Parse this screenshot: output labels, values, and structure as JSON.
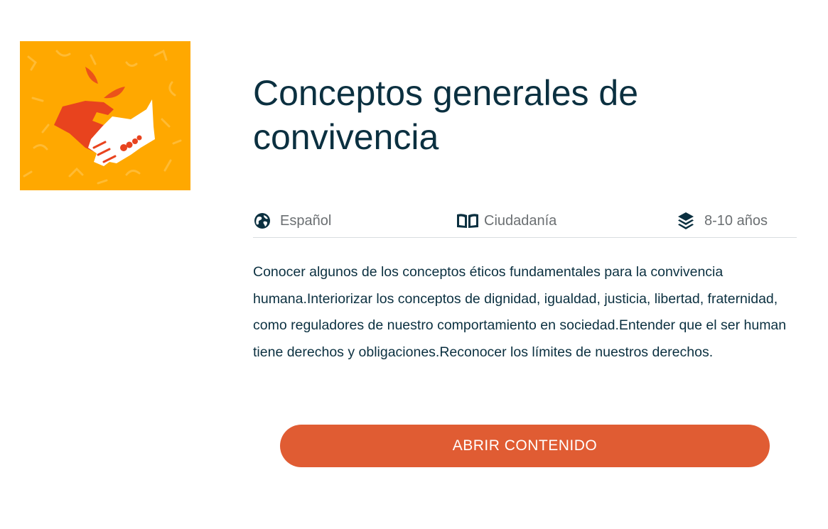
{
  "card": {
    "thumbnail": {
      "icon": "handshake-icon",
      "background_color": "#ffa800",
      "accent_color": "#e8431e"
    },
    "title": "Conceptos generales de convivencia",
    "meta": {
      "language": {
        "icon": "globe-icon",
        "label": "Español"
      },
      "subject": {
        "icon": "book-icon",
        "label": "Ciudadanía"
      },
      "age": {
        "icon": "layers-icon",
        "label": "8-10 años"
      }
    },
    "description": "Conocer algunos de los conceptos éticos fundamentales para la convivencia humana.Interiorizar los conceptos de dignidad, igualdad, justicia, libertad, fraternidad, como reguladores de nuestro comportamiento en sociedad.Entender que el ser human tiene derechos y obligaciones.Reconocer los límites de nuestros derechos.",
    "cta_label": "ABRIR CONTENIDO",
    "colors": {
      "title": "#0b3040",
      "button": "#e05c33",
      "meta_text": "#6b6f72"
    }
  }
}
